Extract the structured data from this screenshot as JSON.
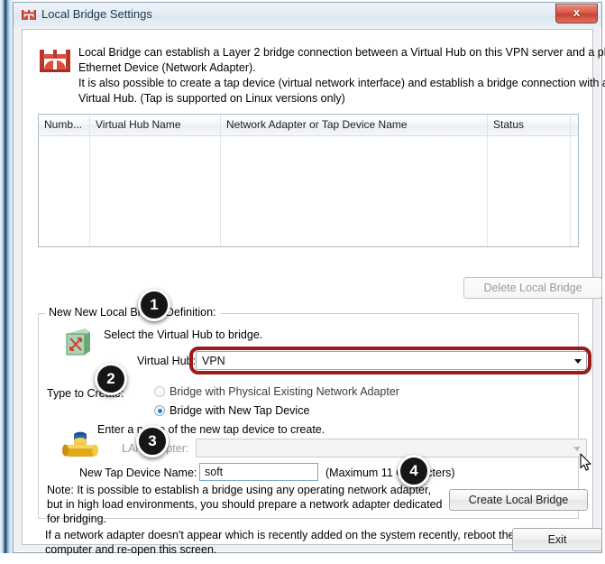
{
  "window": {
    "title": "Local Bridge Settings",
    "title_icon": "bridge-icon",
    "close_label": "x"
  },
  "description": {
    "icon": "bridge-icon",
    "lines": [
      "Local Bridge can establish a Layer 2 bridge connection between a Virtual Hub on this VPN server and a physical",
      "Ethernet Device (Network Adapter).",
      "It is also possible to create a tap device (virtual network interface) and establish a bridge connection with a",
      "Virtual Hub. (Tap is supported on Linux versions only)"
    ]
  },
  "listview": {
    "columns": [
      "Numb...",
      "Virtual Hub Name",
      "Network Adapter or Tap Device Name",
      "Status"
    ],
    "rows": []
  },
  "buttons": {
    "delete_local_bridge": "Delete Local Bridge",
    "create_local_bridge": "Create Local Bridge",
    "exit": "Exit"
  },
  "groupbox": {
    "label": "New New Local Bridge Definition:",
    "hub_icon": "virtual-hub-switch-icon",
    "select_hub_text": "Select the Virtual Hub to bridge.",
    "hub_field_label": "Virtual Hub:",
    "hub_value": "VPN",
    "type_label": "Type to Create:",
    "radio_physical": "Bridge with Physical Existing Network Adapter",
    "radio_tap": "Bridge with New Tap Device",
    "radio_selected": "radio_tap",
    "tap_hint": "Enter a name of the new tap device to create.",
    "pipe_icon": "tap-device-pipe-icon",
    "lan_label": "LAN Adapter:",
    "lan_value": "",
    "tap_name_label": "New Tap Device Name:",
    "tap_name_value": "soft",
    "tap_name_placeholder": "",
    "tap_name_max": "(Maximum 11 Characters)",
    "note_lines": [
      "Note: It is possible to establish a bridge using any operating network adapter,",
      "but in high load environments, you should prepare a network adapter dedicated",
      "for bridging."
    ]
  },
  "footer": {
    "lines": [
      "If a network adapter doesn't appear which is recently added on the system recently, reboot the",
      "computer and re-open this screen."
    ]
  },
  "annotations": {
    "badges": [
      "1",
      "2",
      "3",
      "4"
    ],
    "highlight_color": "#9a1b18",
    "badge_color": "#161616"
  }
}
